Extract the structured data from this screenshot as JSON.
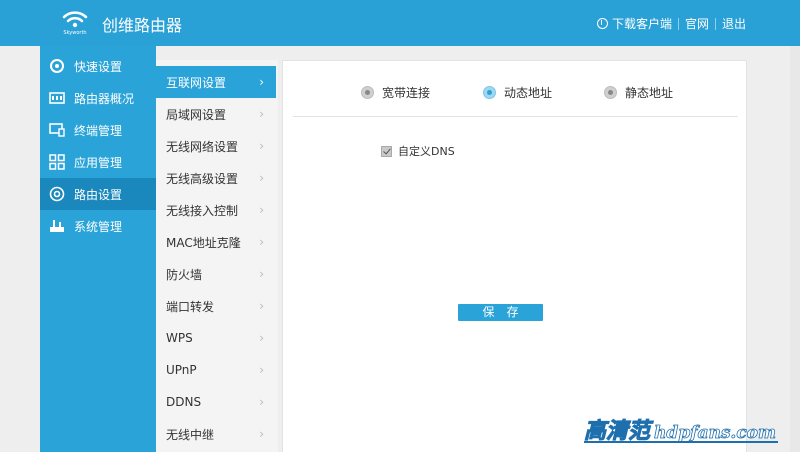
{
  "header": {
    "logo_icon": "wifi-icon",
    "logo_text": "Skyworth",
    "title": "创维路由器",
    "download_label": "下载客户端",
    "official_label": "官网",
    "logout_label": "退出"
  },
  "sidebar": {
    "items": [
      {
        "label": "快速设置",
        "icon": "gear-quick-icon"
      },
      {
        "label": "路由器概况",
        "icon": "router-overview-icon"
      },
      {
        "label": "终端管理",
        "icon": "monitor-icon"
      },
      {
        "label": "应用管理",
        "icon": "apps-grid-icon"
      },
      {
        "label": "路由设置",
        "icon": "settings-icon",
        "active": true
      },
      {
        "label": "系统管理",
        "icon": "system-icon"
      }
    ]
  },
  "submenu": {
    "items": [
      {
        "label": "互联网设置",
        "active": true
      },
      {
        "label": "局域网设置"
      },
      {
        "label": "无线网络设置"
      },
      {
        "label": "无线高级设置"
      },
      {
        "label": "无线接入控制"
      },
      {
        "label": "MAC地址克隆"
      },
      {
        "label": "防火墙"
      },
      {
        "label": "端口转发"
      },
      {
        "label": "WPS"
      },
      {
        "label": "UPnP"
      },
      {
        "label": "DDNS"
      },
      {
        "label": "无线中继"
      }
    ]
  },
  "content": {
    "options": [
      {
        "label": "宽带连接",
        "selected": false
      },
      {
        "label": "动态地址",
        "selected": true
      },
      {
        "label": "静态地址",
        "selected": false
      }
    ],
    "custom_dns_label": "自定义DNS",
    "custom_dns_checked": true,
    "save_label": "保存"
  },
  "watermark": {
    "cn": "高清范",
    "en": "hdpfans.com"
  },
  "colors": {
    "primary": "#29a1d6",
    "active": "#1a88bd"
  }
}
